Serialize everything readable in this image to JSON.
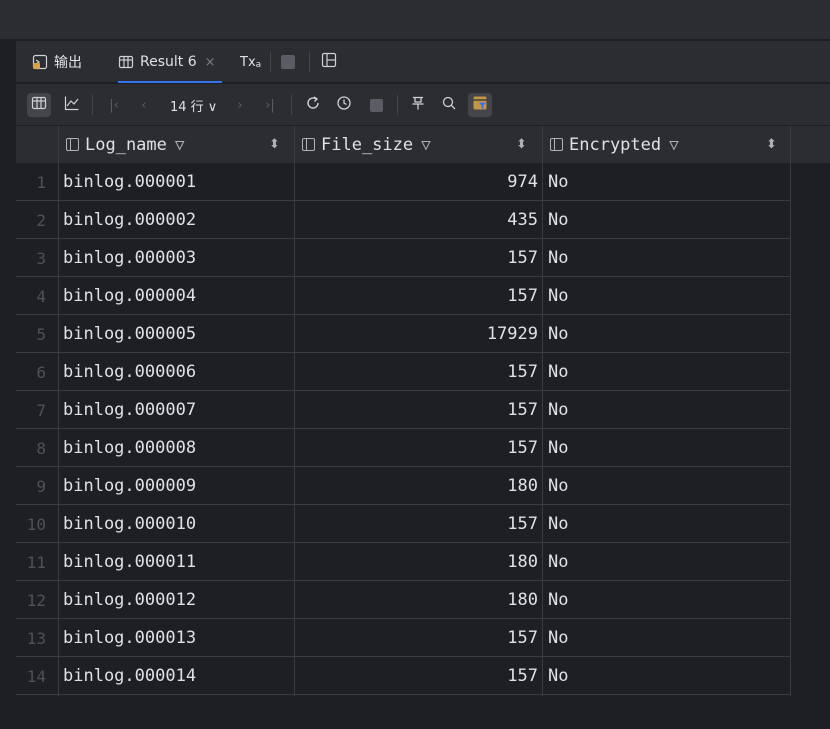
{
  "tabs": {
    "output_label": "输出",
    "result_label": "Result 6",
    "result_close": "×",
    "tx_label": "Tx"
  },
  "toolbar": {
    "rows_label": "14 行 ∨"
  },
  "table": {
    "columns": [
      "Log_name",
      "File_size",
      "Encrypted"
    ],
    "rows": [
      {
        "n": "1",
        "log_name": "binlog.000001",
        "file_size": "974",
        "encrypted": "No"
      },
      {
        "n": "2",
        "log_name": "binlog.000002",
        "file_size": "435",
        "encrypted": "No"
      },
      {
        "n": "3",
        "log_name": "binlog.000003",
        "file_size": "157",
        "encrypted": "No"
      },
      {
        "n": "4",
        "log_name": "binlog.000004",
        "file_size": "157",
        "encrypted": "No"
      },
      {
        "n": "5",
        "log_name": "binlog.000005",
        "file_size": "17929",
        "encrypted": "No"
      },
      {
        "n": "6",
        "log_name": "binlog.000006",
        "file_size": "157",
        "encrypted": "No"
      },
      {
        "n": "7",
        "log_name": "binlog.000007",
        "file_size": "157",
        "encrypted": "No"
      },
      {
        "n": "8",
        "log_name": "binlog.000008",
        "file_size": "157",
        "encrypted": "No"
      },
      {
        "n": "9",
        "log_name": "binlog.000009",
        "file_size": "180",
        "encrypted": "No"
      },
      {
        "n": "10",
        "log_name": "binlog.000010",
        "file_size": "157",
        "encrypted": "No"
      },
      {
        "n": "11",
        "log_name": "binlog.000011",
        "file_size": "180",
        "encrypted": "No"
      },
      {
        "n": "12",
        "log_name": "binlog.000012",
        "file_size": "180",
        "encrypted": "No"
      },
      {
        "n": "13",
        "log_name": "binlog.000013",
        "file_size": "157",
        "encrypted": "No"
      },
      {
        "n": "14",
        "log_name": "binlog.000014",
        "file_size": "157",
        "encrypted": "No"
      }
    ]
  },
  "icons": {
    "output": "console-output-icon",
    "result": "table-grid-icon",
    "tx": "transaction-mode-icon",
    "stop": "stop-icon",
    "layout": "layout-split-icon",
    "column": "column-icon",
    "filter": "filter-funnel-icon",
    "sort": "sort-icon"
  },
  "colors": {
    "background": "#1e1f22",
    "panel": "#2b2d30",
    "accent": "#3574f0",
    "text": "#dfe1e5",
    "row_number": "#4e5157"
  }
}
